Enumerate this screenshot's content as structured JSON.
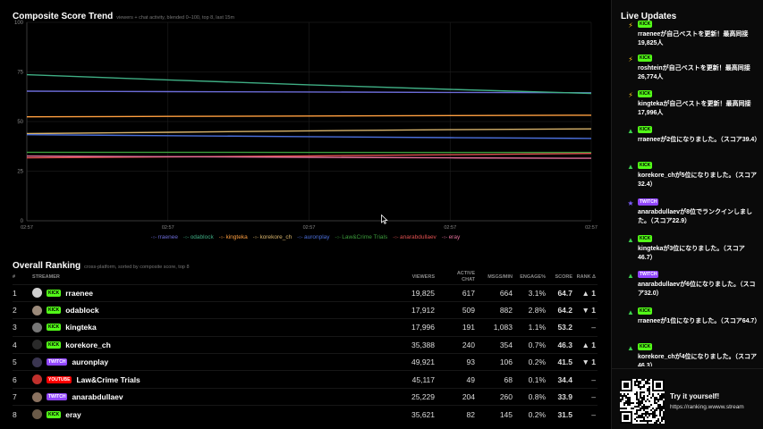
{
  "chart": {
    "title": "Composite Score Trend",
    "subtitle": "viewers + chat activity, blended 0–100, top 8, last 15m"
  },
  "chart_data": {
    "type": "line",
    "title": "Composite Score Trend",
    "ylim": [
      0,
      100
    ],
    "y_ticks": [
      "0",
      "25",
      "50",
      "75",
      "100"
    ],
    "x": [
      "02:57",
      "02:57",
      "02:57",
      "02:57",
      "02:57"
    ],
    "grid": true,
    "legend": "bottom",
    "series": [
      {
        "name": "rraenee",
        "color": "#6b6bd6",
        "values": [
          65.3,
          65.1,
          64.9,
          64.7,
          64.5
        ]
      },
      {
        "name": "odablock",
        "color": "#3fae84",
        "values": [
          73.6,
          71.0,
          68.5,
          66.2,
          64.2
        ]
      },
      {
        "name": "kingteka",
        "color": "#ff9f40",
        "values": [
          52.4,
          52.6,
          52.8,
          53.0,
          53.2
        ]
      },
      {
        "name": "korekore_ch",
        "color": "#d9b46c",
        "values": [
          43.9,
          44.6,
          45.3,
          45.9,
          46.3
        ]
      },
      {
        "name": "auronplay",
        "color": "#4b6fdb",
        "values": [
          43.4,
          42.9,
          42.4,
          41.9,
          41.5
        ]
      },
      {
        "name": "Law&Crime Trials",
        "color": "#3c9c3c",
        "values": [
          34.5,
          34.5,
          34.4,
          34.4,
          34.4
        ]
      },
      {
        "name": "anarabdullaev",
        "color": "#e05050",
        "values": [
          31.7,
          32.2,
          32.7,
          33.3,
          33.9
        ]
      },
      {
        "name": "eray",
        "color": "#e36f9a",
        "values": [
          32.6,
          32.3,
          32.0,
          31.7,
          31.5
        ]
      }
    ]
  },
  "ranking": {
    "title": "Overall Ranking",
    "subtitle": "cross-platform, sorted by composite score, top 8",
    "columns": {
      "num": "#",
      "streamer": "STREAMER",
      "viewers": "VIEWERS",
      "active_chat_1": "ACTIVE",
      "active_chat_2": "CHAT",
      "msgs": "MSGS/MIN",
      "engage": "ENGAGE%",
      "score": "SCORE",
      "rank_delta": "RANK Δ"
    },
    "rows": [
      {
        "num": "1",
        "name": "rraenee",
        "platform": "KICK",
        "viewers": "19,825",
        "chat": "617",
        "msgs": "664",
        "engage": "3.1%",
        "score": "64.7",
        "delta": "▲ 1",
        "dir": "up",
        "avatar": "#cfcfcf"
      },
      {
        "num": "2",
        "name": "odablock",
        "platform": "KICK",
        "viewers": "17,912",
        "chat": "509",
        "msgs": "882",
        "engage": "2.8%",
        "score": "64.2",
        "delta": "▼ 1",
        "dir": "down",
        "avatar": "#9b8a7a"
      },
      {
        "num": "3",
        "name": "kingteka",
        "platform": "KICK",
        "viewers": "17,996",
        "chat": "191",
        "msgs": "1,083",
        "engage": "1.1%",
        "score": "53.2",
        "delta": "–",
        "dir": "flat",
        "avatar": "#777777"
      },
      {
        "num": "4",
        "name": "korekore_ch",
        "platform": "KICK",
        "viewers": "35,388",
        "chat": "240",
        "msgs": "354",
        "engage": "0.7%",
        "score": "46.3",
        "delta": "▲ 1",
        "dir": "up",
        "avatar": "#2a2a2a"
      },
      {
        "num": "5",
        "name": "auronplay",
        "platform": "TWITCH",
        "viewers": "49,921",
        "chat": "93",
        "msgs": "106",
        "engage": "0.2%",
        "score": "41.5",
        "delta": "▼ 1",
        "dir": "down",
        "avatar": "#3a3550"
      },
      {
        "num": "6",
        "name": "Law&Crime Trials",
        "platform": "YOUTUBE",
        "viewers": "45,117",
        "chat": "49",
        "msgs": "68",
        "engage": "0.1%",
        "score": "34.4",
        "delta": "–",
        "dir": "flat",
        "avatar": "#c0302c"
      },
      {
        "num": "7",
        "name": "anarabdullaev",
        "platform": "TWITCH",
        "viewers": "25,229",
        "chat": "204",
        "msgs": "260",
        "engage": "0.8%",
        "score": "33.9",
        "delta": "–",
        "dir": "flat",
        "avatar": "#8a7260"
      },
      {
        "num": "8",
        "name": "eray",
        "platform": "KICK",
        "viewers": "35,621",
        "chat": "82",
        "msgs": "145",
        "engage": "0.2%",
        "score": "31.5",
        "delta": "–",
        "dir": "flat",
        "avatar": "#6a5a48"
      }
    ]
  },
  "updates": {
    "title": "Live Updates",
    "items": [
      {
        "icon": "⚡",
        "type": "bolt",
        "platform": "KICK",
        "text": "rraeneeが自己ベストを更新！最高同接19,825人"
      },
      {
        "icon": "⚡",
        "type": "bolt",
        "platform": "KICK",
        "text": "roshteinが自己ベストを更新！最高同接26,774人"
      },
      {
        "icon": "⚡",
        "type": "bolt",
        "platform": "KICK",
        "text": "kingtekaが自己ベストを更新！最高同接17,996人"
      },
      {
        "icon": "▲",
        "type": "up",
        "platform": "KICK",
        "text": "rraeneeが2位になりました。（スコア39.4）"
      },
      {
        "icon": "▲",
        "type": "up",
        "platform": "KICK",
        "text": "korekore_chが5位になりました。（スコア32.4）"
      },
      {
        "icon": "★",
        "type": "star",
        "platform": "TWITCH",
        "text": "anarabdullaevが8位でランクインしました。（スコア22.9）"
      },
      {
        "icon": "▲",
        "type": "up",
        "platform": "KICK",
        "text": "kingtekaが3位になりました。（スコア46.7）"
      },
      {
        "icon": "▲",
        "type": "up",
        "platform": "TWITCH",
        "text": "anarabdullaevが6位になりました。（スコア32.0）"
      },
      {
        "icon": "▲",
        "type": "up",
        "platform": "KICK",
        "text": "rraeneeが1位になりました。（スコア64.7）"
      },
      {
        "icon": "▲",
        "type": "up",
        "platform": "KICK",
        "text": "korekore_chが4位になりました。（スコア46.3）"
      }
    ]
  },
  "promo": {
    "title": "Try it yourself!",
    "url": "https://ranking.wwww.stream"
  },
  "colors": {
    "kick": "#53fc18",
    "twitch": "#9146ff",
    "youtube": "#ff0000",
    "up": "#3ccf4e",
    "down": "#f04040",
    "star": "#7c5cff"
  }
}
